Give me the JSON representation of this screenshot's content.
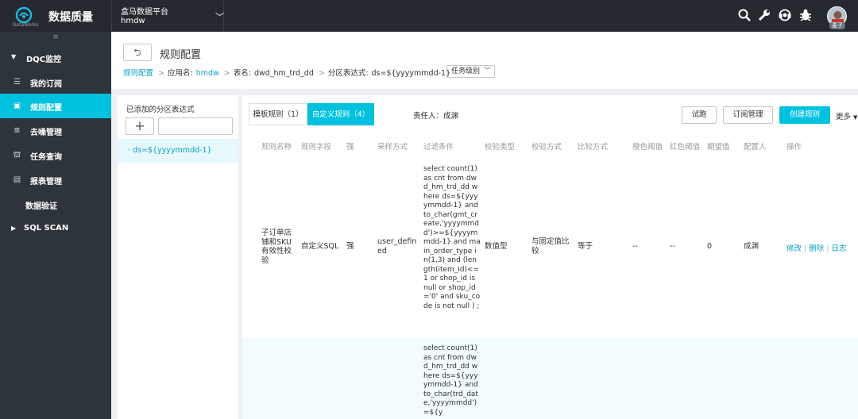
{
  "topbar": {
    "app_title": "数据质量",
    "logo_text": "DataWorks",
    "project_name": "盒马数据平台",
    "project_code": "hmdw",
    "avatar_label": "麦子",
    "icons": [
      "search-icon",
      "wrench-icon",
      "headset-icon",
      "bug-icon"
    ]
  },
  "sidebar": {
    "collapse_glyph": "≡",
    "items": [
      {
        "label": "DQC监控",
        "icon": "caret-down-icon",
        "active": false
      },
      {
        "label": "我的订阅",
        "icon": "subscription-icon",
        "active": false
      },
      {
        "label": "规则配置",
        "icon": "rule-config-icon",
        "active": true
      },
      {
        "label": "去噪管理",
        "icon": "denoise-icon",
        "active": false
      },
      {
        "label": "任务查询",
        "icon": "task-query-icon",
        "active": false
      },
      {
        "label": "报表管理",
        "icon": "report-icon",
        "active": false
      },
      {
        "label": "数据验证",
        "icon": "",
        "active": false
      },
      {
        "label": "SQL SCAN",
        "icon": "caret-right-icon",
        "active": false
      }
    ]
  },
  "header": {
    "back_glyph": "⮌",
    "page_title": "规则配置",
    "breadcrumb": {
      "root": "规则配置",
      "app_label": "应用名:",
      "app_value": "hmdw",
      "table_label": "表名:",
      "table_value": "dwd_hm_trd_dd",
      "partition_label": "分区表达式:",
      "partition_value": "ds=${yyyymmdd-1}"
    },
    "level_select": "任务级别"
  },
  "left_panel": {
    "title": "已添加的分区表达式",
    "add_glyph": "+",
    "input_value": "",
    "items": [
      "· ds=${yyyymmdd-1}"
    ]
  },
  "right_panel": {
    "tabs": [
      "模板规则（1）",
      "自定义规则（4）"
    ],
    "owner": "责任人：成渊",
    "buttons": {
      "trial": "试跑",
      "subscribe": "订阅管理",
      "create": "创建规则"
    },
    "more": "更多",
    "columns": [
      "规则名称",
      "规则字段",
      "强",
      "采样方式",
      "过滤条件",
      "校验类型",
      "校验方式",
      "比较方式",
      "橙色阈值",
      "红色阈值",
      "期望值",
      "配置人",
      "操作"
    ],
    "rows": [
      {
        "name": "子订单店铺和SKU有效性校验",
        "field": "自定义SQL",
        "strong": "强",
        "sampling": "user_defined",
        "condition": "select count(1) as cnt from dwd_hm_trd_dd where ds=${yyyymmdd-1} and to_char(gmt_create,'yyyymmdd')>=${yyyymmdd-1} and main_order_type in(1,3) and (length(item_id)<=1 or shop_id is null or shop_id='0' and sku_code is not null ) ;",
        "check_type": "数值型",
        "check_method": "与固定值比较",
        "compare": "等于",
        "orange": "--",
        "red": "--",
        "expected": "0",
        "configurer": "成渊",
        "ops": [
          "修改",
          "删除",
          "日志"
        ]
      },
      {
        "name": "",
        "field": "",
        "strong": "",
        "sampling": "",
        "condition": "select count(1) as cnt from dwd_hm_trd_dd where ds=${yyyymmdd-1} and to_char(trd_date,'yyyymmdd')=${y",
        "check_type": "",
        "check_method": "",
        "compare": "",
        "orange": "",
        "red": "",
        "expected": "",
        "configurer": "",
        "ops": []
      }
    ]
  },
  "colors": {
    "accent": "#00c1de",
    "link": "#0aa0c9",
    "topbar": "#252a31",
    "sidebar": "#2e343b"
  }
}
